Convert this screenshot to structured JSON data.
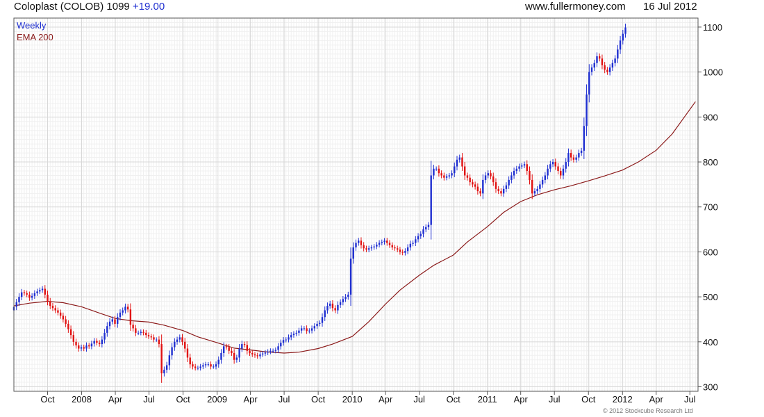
{
  "header": {
    "name": "Coloplast (COLOB)",
    "price": "1099",
    "change": "+19.00",
    "site": "www.fullermoney.com",
    "date": "16 Jul 2012"
  },
  "footer": {
    "copyright": "© 2012 Stockcube Research Ltd"
  },
  "colors": {
    "up": "#1e2ed0",
    "down": "#e01010",
    "ema": "#8b1a1a",
    "grid": "#d8d8d8"
  },
  "chart_data": {
    "type": "candlestick",
    "ylim": [
      290,
      1120
    ],
    "yticks": [
      300,
      400,
      500,
      600,
      700,
      800,
      900,
      1000,
      1100
    ],
    "xlim": [
      "2007-07-02",
      "2012-07-23"
    ],
    "xticks": [
      {
        "label": "Oct",
        "date": "2007-10-01"
      },
      {
        "label": "2008",
        "date": "2008-01-01"
      },
      {
        "label": "Apr",
        "date": "2008-04-01"
      },
      {
        "label": "Jul",
        "date": "2008-07-01"
      },
      {
        "label": "Oct",
        "date": "2008-10-01"
      },
      {
        "label": "2009",
        "date": "2009-01-01"
      },
      {
        "label": "Apr",
        "date": "2009-04-01"
      },
      {
        "label": "Jul",
        "date": "2009-07-01"
      },
      {
        "label": "Oct",
        "date": "2009-10-01"
      },
      {
        "label": "2010",
        "date": "2010-01-01"
      },
      {
        "label": "Apr",
        "date": "2010-04-01"
      },
      {
        "label": "Jul",
        "date": "2010-07-01"
      },
      {
        "label": "Oct",
        "date": "2010-10-01"
      },
      {
        "label": "2011",
        "date": "2011-01-01"
      },
      {
        "label": "Apr",
        "date": "2011-04-01"
      },
      {
        "label": "Jul",
        "date": "2011-07-01"
      },
      {
        "label": "Oct",
        "date": "2011-10-01"
      },
      {
        "label": "2012",
        "date": "2012-01-01"
      },
      {
        "label": "Apr",
        "date": "2012-04-01"
      },
      {
        "label": "Jul",
        "date": "2012-07-01"
      }
    ],
    "grid": true,
    "legend": {
      "position": "top-left",
      "entries": [
        "Weekly",
        "EMA 200"
      ]
    },
    "weekly_close": {
      "start": "2007-07-02",
      "interval_days": 7,
      "values": [
        478,
        488,
        500,
        510,
        508,
        505,
        498,
        502,
        508,
        512,
        515,
        518,
        505,
        490,
        480,
        475,
        470,
        465,
        458,
        450,
        440,
        428,
        415,
        400,
        392,
        385,
        388,
        385,
        392,
        390,
        396,
        402,
        398,
        395,
        405,
        420,
        435,
        445,
        450,
        440,
        455,
        465,
        470,
        478,
        472,
        438,
        430,
        420,
        420,
        422,
        420,
        415,
        412,
        410,
        405,
        405,
        395,
        330,
        338,
        348,
        370,
        388,
        400,
        405,
        410,
        400,
        385,
        365,
        350,
        345,
        342,
        342,
        345,
        348,
        350,
        350,
        345,
        345,
        350,
        360,
        375,
        390,
        388,
        380,
        375,
        360,
        365,
        385,
        395,
        393,
        380,
        375,
        372,
        370,
        368,
        372,
        374,
        376,
        378,
        380,
        380,
        382,
        390,
        398,
        404,
        405,
        410,
        415,
        418,
        420,
        425,
        430,
        430,
        424,
        425,
        430,
        435,
        440,
        442,
        455,
        470,
        480,
        485,
        475,
        470,
        482,
        488,
        495,
        500,
        505,
        585,
        610,
        620,
        625,
        615,
        608,
        605,
        608,
        610,
        612,
        616,
        620,
        622,
        625,
        620,
        615,
        610,
        608,
        605,
        600,
        598,
        602,
        610,
        618,
        620,
        628,
        635,
        640,
        650,
        655,
        660,
        770,
        785,
        785,
        775,
        770,
        765,
        768,
        770,
        775,
        790,
        805,
        810,
        790,
        770,
        765,
        755,
        750,
        745,
        735,
        730,
        760,
        770,
        775,
        768,
        755,
        740,
        735,
        730,
        740,
        748,
        760,
        770,
        780,
        785,
        790,
        792,
        795,
        780,
        760,
        730,
        735,
        740,
        750,
        760,
        770,
        785,
        795,
        800,
        790,
        780,
        770,
        785,
        800,
        820,
        810,
        805,
        810,
        820,
        825,
        880,
        950,
        1000,
        1010,
        1020,
        1035,
        1030,
        1015,
        1005,
        1000,
        1010,
        1020,
        1030,
        1050,
        1070,
        1085,
        1099
      ]
    },
    "ema200": {
      "points": [
        [
          "2007-07-02",
          480
        ],
        [
          "2007-08-13",
          486
        ],
        [
          "2007-10-01",
          490
        ],
        [
          "2007-11-12",
          487
        ],
        [
          "2008-01-01",
          478
        ],
        [
          "2008-02-18",
          464
        ],
        [
          "2008-04-01",
          452
        ],
        [
          "2008-05-12",
          447
        ],
        [
          "2008-07-01",
          444
        ],
        [
          "2008-08-11",
          437
        ],
        [
          "2008-10-01",
          425
        ],
        [
          "2008-11-10",
          411
        ],
        [
          "2009-01-01",
          398
        ],
        [
          "2009-02-16",
          386
        ],
        [
          "2009-04-01",
          382
        ],
        [
          "2009-05-11",
          378
        ],
        [
          "2009-07-01",
          375
        ],
        [
          "2009-08-10",
          377
        ],
        [
          "2009-10-01",
          385
        ],
        [
          "2009-11-09",
          395
        ],
        [
          "2010-01-01",
          412
        ],
        [
          "2010-02-15",
          445
        ],
        [
          "2010-04-01",
          484
        ],
        [
          "2010-05-10",
          515
        ],
        [
          "2010-07-01",
          548
        ],
        [
          "2010-08-09",
          570
        ],
        [
          "2010-10-01",
          593
        ],
        [
          "2010-11-08",
          622
        ],
        [
          "2011-01-01",
          656
        ],
        [
          "2011-02-14",
          688
        ],
        [
          "2011-04-01",
          712
        ],
        [
          "2011-05-16",
          727
        ],
        [
          "2011-07-01",
          738
        ],
        [
          "2011-08-15",
          747
        ],
        [
          "2011-10-01",
          758
        ],
        [
          "2011-11-14",
          769
        ],
        [
          "2012-01-01",
          782
        ],
        [
          "2012-02-13",
          800
        ],
        [
          "2012-04-01",
          826
        ],
        [
          "2012-05-14",
          862
        ],
        [
          "2012-07-16",
          934
        ]
      ]
    }
  }
}
